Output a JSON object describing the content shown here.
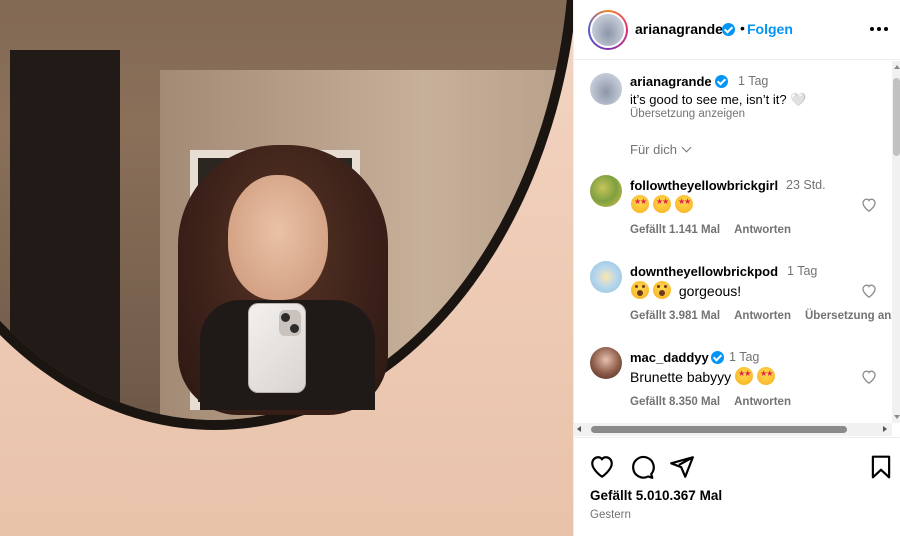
{
  "post": {
    "username": "arianagrande",
    "follow_label": "Folgen",
    "dot": "•"
  },
  "caption": {
    "username": "arianagrande",
    "time": "1 Tag",
    "text": "it’s good to see me, isn’t it? 🤍",
    "translate_label": "Übersetzung anzeigen"
  },
  "sort_label": "Für dich",
  "comments": [
    {
      "username": "followtheyellowbrickgirl",
      "time": "23 Std.",
      "text": "",
      "emojis": [
        "star-struck",
        "star-struck",
        "star-struck"
      ],
      "likes_label": "Gefällt 1.141 Mal",
      "reply_label": "Antworten"
    },
    {
      "username": "downtheyellowbrickpod",
      "time": "1 Tag",
      "text": "gorgeous!",
      "emojis": [
        "astonished",
        "astonished"
      ],
      "likes_label": "Gefällt 3.981 Mal",
      "reply_label": "Antworten",
      "translate_label": "Übersetzung anz"
    },
    {
      "username": "mac_daddyy",
      "time": "1 Tag",
      "text": "Brunette babyyy",
      "emojis": [
        "star-struck",
        "star-struck"
      ],
      "likes_label": "Gefällt 8.350 Mal",
      "reply_label": "Antworten"
    }
  ],
  "footer": {
    "likes_label": "Gefällt 5.010.367 Mal",
    "posted_label": "Gestern"
  },
  "icons": {
    "like": "heart-icon",
    "comment": "comment-icon",
    "share": "share-icon",
    "save": "bookmark-icon",
    "more": "more-options-icon",
    "verified": "verified-badge-icon"
  },
  "colors": {
    "link": "#0095f6",
    "muted": "#737373",
    "border": "#efefef"
  }
}
